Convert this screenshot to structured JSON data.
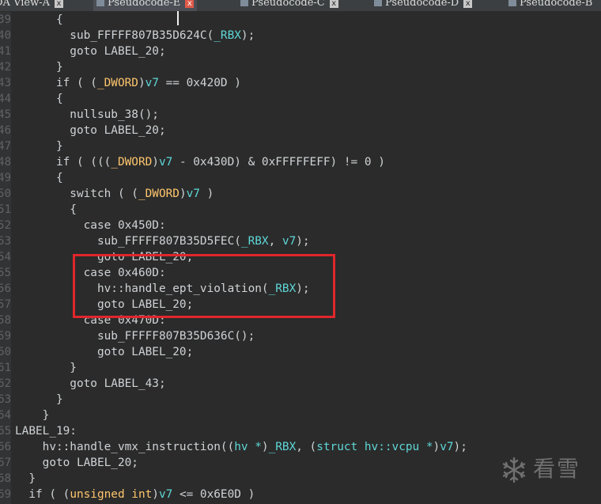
{
  "tabs": [
    {
      "label": "IDA View-A",
      "active": false,
      "close_color": "gray"
    },
    {
      "label": "Pseudocode-E",
      "active": true,
      "close_color": "red"
    },
    {
      "label": "Pseudocode-C",
      "active": false,
      "close_color": "gray"
    },
    {
      "label": "Pseudocode-D",
      "active": false,
      "close_color": "gray"
    },
    {
      "label": "Pseudocode-B",
      "active": false,
      "close_color": "gray"
    }
  ],
  "close_glyph": "x",
  "line_numbers": [
    "39",
    "40",
    "41",
    "42",
    "43",
    "44",
    "45",
    "46",
    "47",
    "48",
    "49",
    "50",
    "51",
    "52",
    "53",
    "54",
    "55",
    "56",
    "57",
    "58",
    "59",
    "60",
    "61",
    "62",
    "63",
    "64",
    "65",
    "66",
    "67",
    "68",
    "69"
  ],
  "code_lines": [
    [
      {
        "t": "      {",
        "c": "kw"
      }
    ],
    [
      {
        "t": "        sub_FFFFF807B35D624C(",
        "c": "kw"
      },
      {
        "t": "_RBX",
        "c": "var"
      },
      {
        "t": ");",
        "c": "kw"
      }
    ],
    [
      {
        "t": "        goto LABEL_20;",
        "c": "kw"
      }
    ],
    [
      {
        "t": "      }",
        "c": "kw"
      }
    ],
    [
      {
        "t": "      if ( (",
        "c": "kw"
      },
      {
        "t": "_DWORD",
        "c": "ty"
      },
      {
        "t": ")",
        "c": "kw"
      },
      {
        "t": "v7",
        "c": "var"
      },
      {
        "t": " == 0x420D )",
        "c": "kw"
      }
    ],
    [
      {
        "t": "      {",
        "c": "kw"
      }
    ],
    [
      {
        "t": "        nullsub_38();",
        "c": "kw"
      }
    ],
    [
      {
        "t": "        goto LABEL_20;",
        "c": "kw"
      }
    ],
    [
      {
        "t": "      }",
        "c": "kw"
      }
    ],
    [
      {
        "t": "      if ( (((",
        "c": "kw"
      },
      {
        "t": "_DWORD",
        "c": "ty"
      },
      {
        "t": ")",
        "c": "kw"
      },
      {
        "t": "v7",
        "c": "var"
      },
      {
        "t": " - 0x430D) & 0xFFFFFEFF) != 0 )",
        "c": "kw"
      }
    ],
    [
      {
        "t": "      {",
        "c": "kw"
      }
    ],
    [
      {
        "t": "        switch ( (",
        "c": "kw"
      },
      {
        "t": "_DWORD",
        "c": "ty"
      },
      {
        "t": ")",
        "c": "kw"
      },
      {
        "t": "v7",
        "c": "var"
      },
      {
        "t": " )",
        "c": "kw"
      }
    ],
    [
      {
        "t": "        {",
        "c": "kw"
      }
    ],
    [
      {
        "t": "          case 0x450D:",
        "c": "kw"
      }
    ],
    [
      {
        "t": "            sub_FFFFF807B35D5FEC(",
        "c": "kw"
      },
      {
        "t": "_RBX",
        "c": "var"
      },
      {
        "t": ", ",
        "c": "kw"
      },
      {
        "t": "v7",
        "c": "var"
      },
      {
        "t": ");",
        "c": "kw"
      }
    ],
    [
      {
        "t": "            goto LABEL_20;",
        "c": "kw"
      }
    ],
    [
      {
        "t": "          case 0x460D:",
        "c": "kw"
      }
    ],
    [
      {
        "t": "            hv::handle_ept_violation(",
        "c": "kw"
      },
      {
        "t": "_RBX",
        "c": "var"
      },
      {
        "t": ");",
        "c": "kw"
      }
    ],
    [
      {
        "t": "            goto LABEL_20;",
        "c": "kw"
      }
    ],
    [
      {
        "t": "          case 0x470D:",
        "c": "kw"
      }
    ],
    [
      {
        "t": "            sub_FFFFF807B35D636C();",
        "c": "kw"
      }
    ],
    [
      {
        "t": "            goto LABEL_20;",
        "c": "kw"
      }
    ],
    [
      {
        "t": "        }",
        "c": "kw"
      }
    ],
    [
      {
        "t": "        goto LABEL_43;",
        "c": "kw"
      }
    ],
    [
      {
        "t": "      }",
        "c": "kw"
      }
    ],
    [
      {
        "t": "    }",
        "c": "kw"
      }
    ],
    [
      {
        "t": "LABEL_19:",
        "c": "lbl"
      }
    ],
    [
      {
        "t": "    hv::handle_vmx_instruction((",
        "c": "kw"
      },
      {
        "t": "hv *",
        "c": "var"
      },
      {
        "t": ")",
        "c": "kw"
      },
      {
        "t": "_RBX",
        "c": "var"
      },
      {
        "t": ", (",
        "c": "kw"
      },
      {
        "t": "struct hv::vcpu *",
        "c": "var"
      },
      {
        "t": ")",
        "c": "kw"
      },
      {
        "t": "v7",
        "c": "var"
      },
      {
        "t": ");",
        "c": "kw"
      }
    ],
    [
      {
        "t": "    goto LABEL_20;",
        "c": "kw"
      }
    ],
    [
      {
        "t": "  }",
        "c": "kw"
      }
    ],
    [
      {
        "t": "  if ( (",
        "c": "kw"
      },
      {
        "t": "unsigned int",
        "c": "ty"
      },
      {
        "t": ")",
        "c": "kw"
      },
      {
        "t": "v7",
        "c": "var"
      },
      {
        "t": " <= 0x6E0D )",
        "c": "kw"
      }
    ]
  ],
  "watermark": {
    "text": "看雪",
    "icon": "snowflake-icon"
  },
  "colors": {
    "background": "#2b2b2b",
    "gutter": "#313335",
    "text": "#cfd3d6",
    "type_keyword": "#ffc66d",
    "variable": "#5fd7d7",
    "highlight_border": "#e0262c"
  }
}
